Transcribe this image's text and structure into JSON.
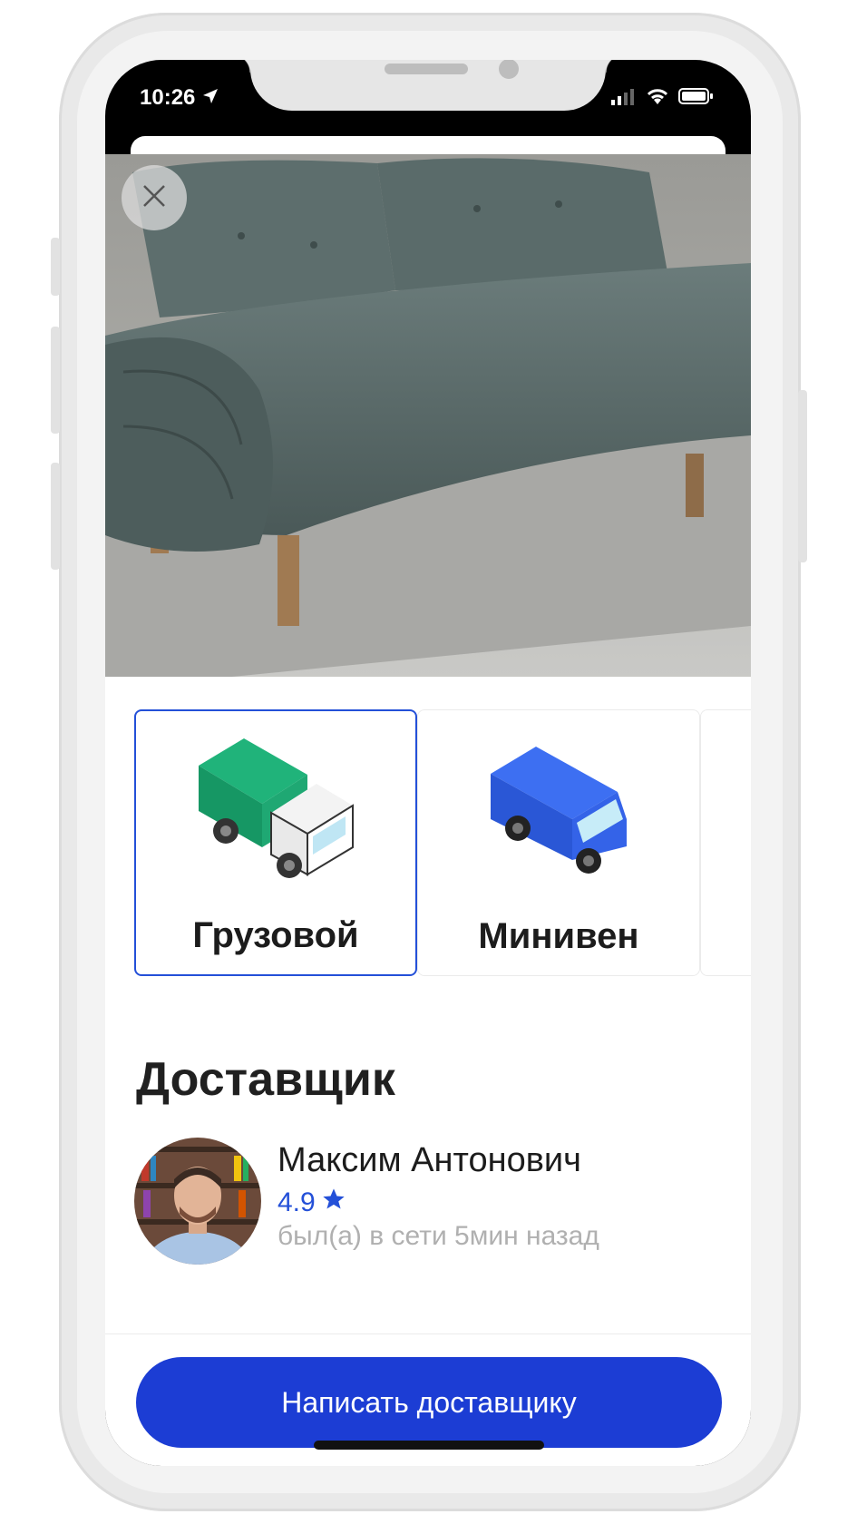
{
  "status_bar": {
    "time": "10:26"
  },
  "vehicles": [
    {
      "label": "Грузовой",
      "selected": true
    },
    {
      "label": "Минивен",
      "selected": false
    }
  ],
  "courier": {
    "section_title": "Доставщик",
    "name": "Максим Антонович",
    "rating": "4.9",
    "last_seen": "был(а) в сети 5мин назад"
  },
  "cta": {
    "label": "Написать доставщику"
  },
  "colors": {
    "accent": "#1c3dd4",
    "selected_border": "#2450d8",
    "rating": "#2450d8"
  }
}
